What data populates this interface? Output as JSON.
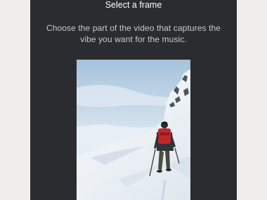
{
  "modal": {
    "title": "Select a frame",
    "instructions": "Choose the part of the video that captures the vibe you want for the music."
  },
  "frame_preview": {
    "icon": "mountain-hiker-photo",
    "colors": {
      "sky_top": "#a9c4dd",
      "sky_bottom": "#eef4f8",
      "snow": "#f3f5f7",
      "snow_shadow": "#cfdbe6",
      "rock": "#4a5560",
      "jacket": "#c1262b",
      "pants": "#4b4f3e"
    }
  },
  "colors": {
    "panel_bg": "#2b2c30",
    "page_bg": "#efeeea",
    "title_text": "#ffffff",
    "body_text": "#c9cacd"
  }
}
